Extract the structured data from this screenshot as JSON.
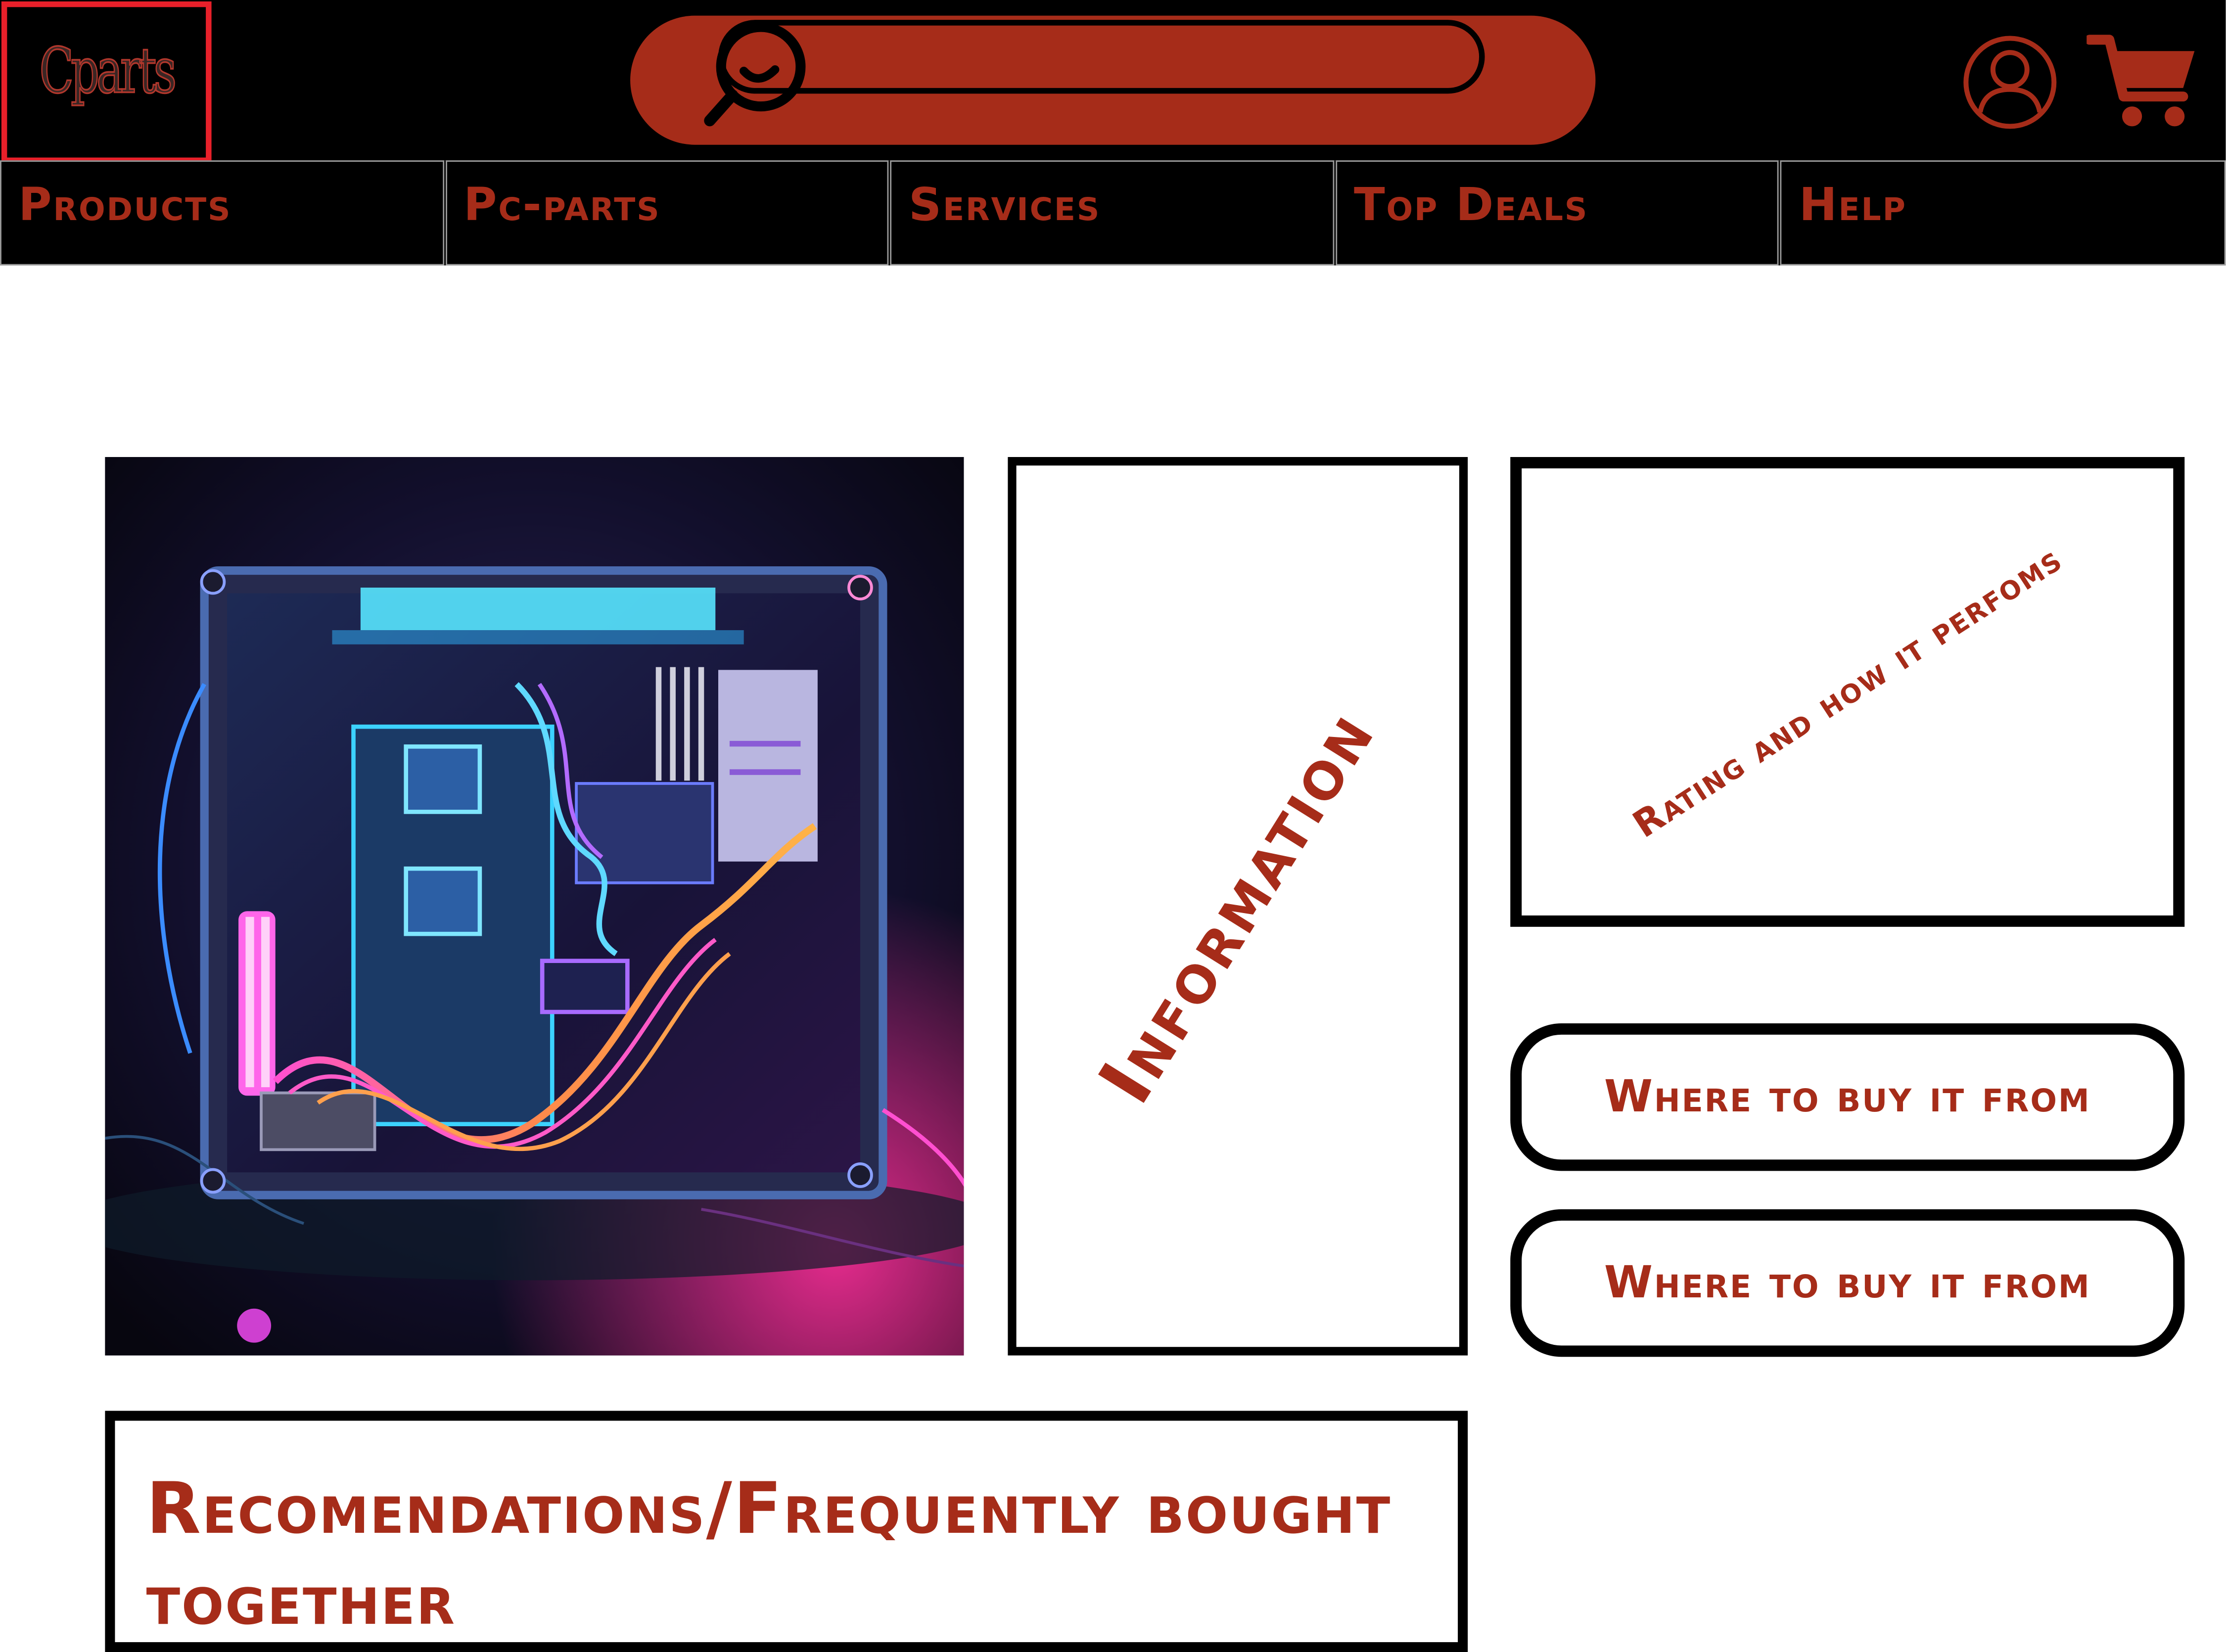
{
  "header": {
    "logo_text": "Cparts",
    "search_placeholder": ""
  },
  "nav": {
    "items": [
      {
        "label": "Products"
      },
      {
        "label": "Pc-parts"
      },
      {
        "label": "Services"
      },
      {
        "label": "Top Deals"
      },
      {
        "label": "Help"
      }
    ]
  },
  "product": {
    "information_label": "Information",
    "rating_label": "Rating and how it perfoms",
    "buy_buttons": [
      {
        "label": "Where to buy it from"
      },
      {
        "label": "Where to buy it from"
      }
    ]
  },
  "recommendations": {
    "title": "Recomendations/Frequently bought together"
  },
  "colors": {
    "accent": "#a62c19",
    "logo_border": "#e8202a",
    "header_bg": "#000000"
  },
  "icons": {
    "search": "search-icon",
    "user": "user-icon",
    "cart": "cart-icon"
  }
}
